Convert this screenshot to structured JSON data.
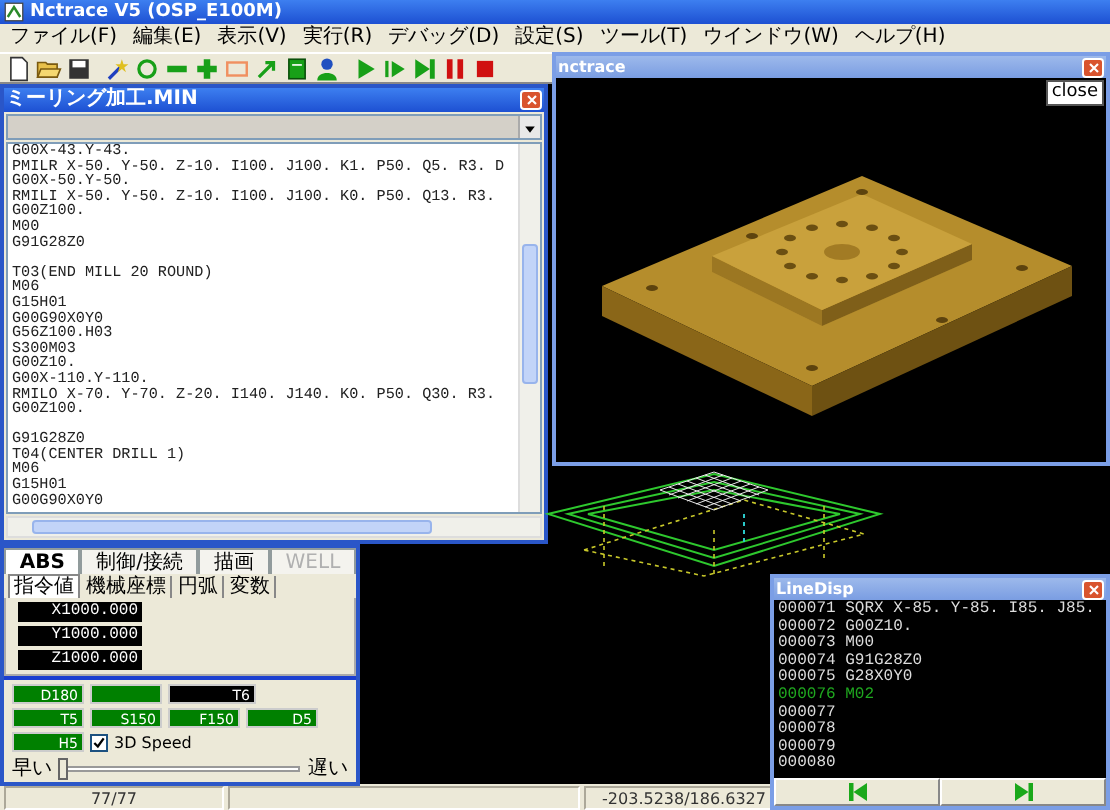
{
  "window": {
    "title": "Nctrace V5 (OSP_E100M)"
  },
  "menu": [
    "ファイル(F)",
    "編集(E)",
    "表示(V)",
    "実行(R)",
    "デバッグ(D)",
    "設定(S)",
    "ツール(T)",
    "ウインドウ(W)",
    "ヘルプ(H)"
  ],
  "editor": {
    "title": "ミーリング加工.MIN",
    "blocks": [
      [
        "G00X-43.Y-43.",
        "PMILR X-50. Y-50. Z-10. I100. J100. K1. P50. Q5. R3. D",
        "G00X-50.Y-50.",
        "RMILI X-50. Y-50. Z-10. I100. J100. K0. P50. Q13. R3.",
        "G00Z100.",
        "M00",
        "G91G28Z0"
      ],
      [
        "T03(END MILL 20 ROUND)",
        "M06",
        "G15H01",
        "G00G90X0Y0",
        "G56Z100.H03",
        "S300M03",
        "G00Z10.",
        "G00X-110.Y-110.",
        "RMILO X-70. Y-70. Z-20. I140. J140. K0. P50. Q30. R3.",
        "G00Z100."
      ],
      [
        "G91G28Z0",
        "T04(CENTER DRILL 1)",
        "M06",
        "G15H01",
        "G00G90X0Y0"
      ]
    ]
  },
  "control_panel": {
    "tabs": [
      {
        "label": "ABS",
        "selected": true,
        "disabled": false
      },
      {
        "label": "制御/接続",
        "selected": false,
        "disabled": false
      },
      {
        "label": "描画",
        "selected": false,
        "disabled": false
      },
      {
        "label": "WELL",
        "selected": false,
        "disabled": true
      }
    ],
    "subtabs": [
      {
        "label": "指令値",
        "selected": true
      },
      {
        "label": "機械座標",
        "selected": false
      },
      {
        "label": "円弧",
        "selected": false
      },
      {
        "label": "変数",
        "selected": false
      }
    ],
    "coordinates": [
      "X1000.000",
      "Y1000.000",
      "Z1000.000"
    ],
    "indicators": [
      [
        {
          "text": "D180",
          "color": "#008000"
        },
        {
          "color": "#008000"
        },
        {
          "text": "T6",
          "color": "#000000"
        }
      ],
      [
        {
          "text": "T5",
          "color": "#008000"
        },
        {
          "text": "S150",
          "color": "#008000"
        },
        {
          "text": "F150",
          "color": "#008000"
        },
        {
          "text": "D5",
          "color": "#008000"
        }
      ],
      [
        {
          "text": "H5",
          "color": "#008000"
        }
      ]
    ],
    "speed_3d": {
      "label": "3D Speed",
      "checked": true
    },
    "speed_slider": {
      "min_label": "早い",
      "max_label": "遅い",
      "level": 0
    }
  },
  "viewer": {
    "title": "nctrace",
    "tooltip": "close"
  },
  "line_display": {
    "title": "LineDisp",
    "lines": [
      {
        "number": "000071",
        "code": "SQRX X-85. Y-85. I85. J85.",
        "selected": false
      },
      {
        "number": "000072",
        "code": "G00Z10.",
        "selected": false
      },
      {
        "number": "000073",
        "code": "M00",
        "selected": false
      },
      {
        "number": "000074",
        "code": "G91G28Z0",
        "selected": false
      },
      {
        "number": "000075",
        "code": "G28X0Y0",
        "selected": false
      },
      {
        "number": "000076",
        "code": "M02",
        "selected": true
      },
      {
        "number": "000077",
        "selected": false
      },
      {
        "number": "000078",
        "selected": false
      },
      {
        "number": "000079",
        "selected": false
      },
      {
        "number": "000080",
        "selected": false
      }
    ]
  },
  "status_bar": [
    "77/77",
    "-203.5238/186.6327"
  ]
}
